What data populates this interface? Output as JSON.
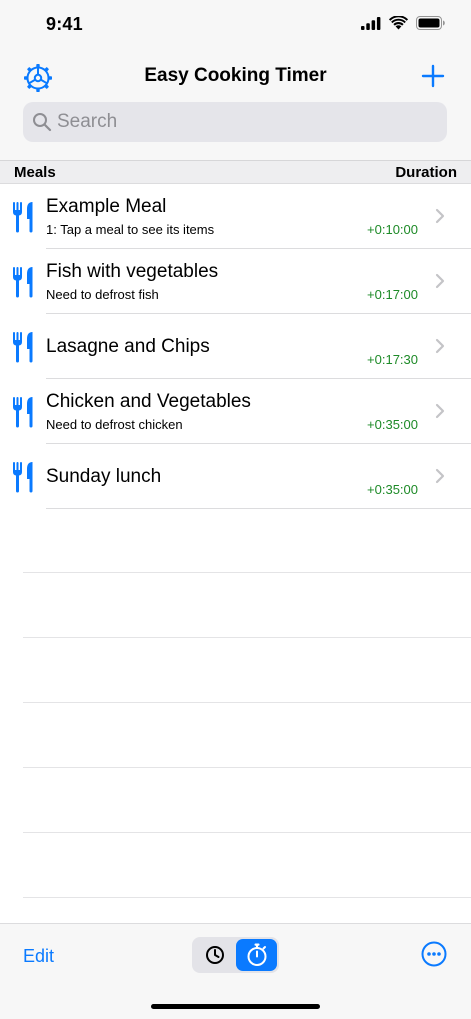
{
  "status": {
    "time": "9:41"
  },
  "nav": {
    "title": "Easy Cooking Timer"
  },
  "search": {
    "placeholder": "Search"
  },
  "header": {
    "meals": "Meals",
    "duration": "Duration"
  },
  "meals": [
    {
      "title": "Example Meal",
      "subtitle": "1: Tap a meal to see its items",
      "duration": "+0:10:00"
    },
    {
      "title": "Fish with vegetables",
      "subtitle": "Need to defrost fish",
      "duration": "+0:17:00"
    },
    {
      "title": "Lasagne and Chips",
      "subtitle": "",
      "duration": "+0:17:30"
    },
    {
      "title": "Chicken and Vegetables",
      "subtitle": "Need to defrost chicken",
      "duration": "+0:35:00"
    },
    {
      "title": "Sunday lunch",
      "subtitle": "",
      "duration": "+0:35:00"
    }
  ],
  "toolbar": {
    "edit_label": "Edit"
  },
  "colors": {
    "accent": "#0a7aff",
    "duration": "#1d8a27",
    "chevron": "#c4c4c7"
  },
  "icons": [
    "settings-gear-icon",
    "plus-icon",
    "search-icon",
    "fork-knife-icon",
    "chevron-right-icon",
    "clock-icon",
    "stopwatch-icon",
    "more-ellipsis-icon"
  ]
}
